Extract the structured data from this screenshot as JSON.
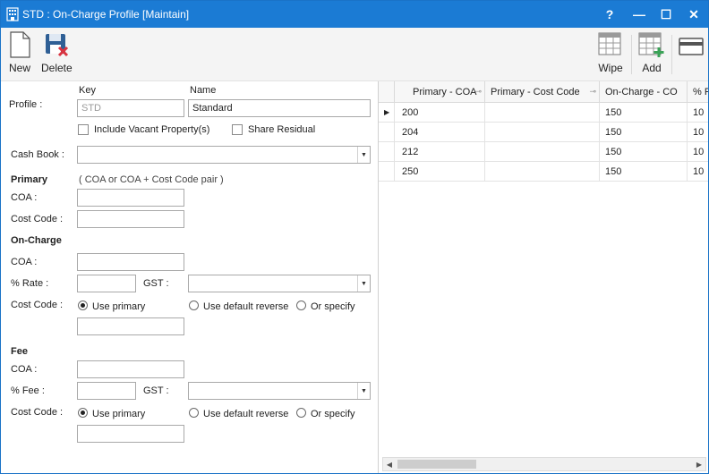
{
  "window": {
    "title": "STD : On-Charge Profile [Maintain]",
    "controls": {
      "help": "?",
      "minimize": "—",
      "maximize": "☐",
      "close": "✕"
    }
  },
  "toolbar": {
    "new_label": "New",
    "delete_label": "Delete",
    "wipe_label": "Wipe",
    "add_label": "Add"
  },
  "form": {
    "profile_label": "Profile :",
    "key_header": "Key",
    "name_header": "Name",
    "key_value": "STD",
    "name_value": "Standard",
    "include_vacant_label": "Include Vacant Property(s)",
    "share_residual_label": "Share Residual",
    "cash_book_label": "Cash Book :",
    "cash_book_value": "",
    "primary": {
      "heading": "Primary",
      "hint": "( COA or COA + Cost Code pair )",
      "coa_label": "COA :",
      "coa_value": "",
      "cost_code_label": "Cost Code :",
      "cost_code_value": ""
    },
    "on_charge": {
      "heading": "On-Charge",
      "coa_label": "COA :",
      "coa_value": "",
      "rate_label": "% Rate :",
      "rate_value": "",
      "gst_label": "GST :",
      "gst_value": "",
      "cost_code_label": "Cost Code :",
      "opt_use_primary": "Use primary",
      "opt_default_reverse": "Use default reverse",
      "opt_or_specify": "Or specify",
      "specify_value": ""
    },
    "fee": {
      "heading": "Fee",
      "coa_label": "COA :",
      "coa_value": "",
      "fee_label": "% Fee :",
      "fee_value": "",
      "gst_label": "GST :",
      "gst_value": "",
      "cost_code_label": "Cost Code :",
      "opt_use_primary": "Use primary",
      "opt_default_reverse": "Use default reverse",
      "opt_or_specify": "Or specify",
      "specify_value": ""
    }
  },
  "grid": {
    "columns": [
      "Primary - COA",
      "Primary - Cost Code",
      "On-Charge - CO",
      "% R"
    ],
    "rows": [
      [
        "200",
        "",
        "150",
        "10"
      ],
      [
        "204",
        "",
        "150",
        "10"
      ],
      [
        "212",
        "",
        "150",
        "10"
      ],
      [
        "250",
        "",
        "150",
        "10"
      ]
    ]
  },
  "colors": {
    "titlebar": "#1b7bd4",
    "accent_green": "#3aa357",
    "delete_red": "#d9333f"
  }
}
